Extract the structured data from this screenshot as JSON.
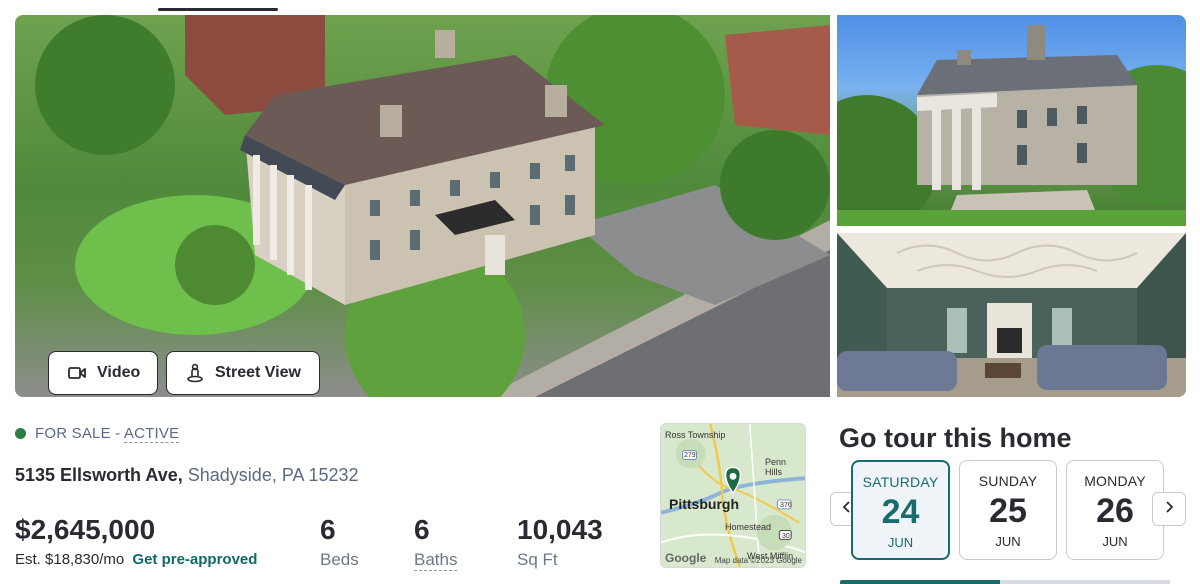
{
  "gallery": {
    "video_label": "Video",
    "street_view_label": "Street View"
  },
  "listing": {
    "status_prefix": "FOR SALE - ",
    "status_active": "ACTIVE",
    "status_color": "#2e7d49",
    "street": "5135 Ellsworth Ave,",
    "locality": "Shadyside, PA 15232",
    "price": "$2,645,000",
    "est_payment": "Est. $18,830/mo",
    "preapproved_link": "Get pre-approved",
    "beds_value": "6",
    "beds_label": "Beds",
    "baths_value": "6",
    "baths_label": "Baths",
    "sqft_value": "10,043",
    "sqft_label": "Sq Ft"
  },
  "map": {
    "label_ross": "Ross Township",
    "label_penn": "Penn Hills",
    "label_city": "Pittsburgh",
    "label_homestead": "Homestead",
    "label_mifflin": "West Mifflin",
    "hwy_279": "279",
    "hwy_376": "376",
    "hwy_30": "30",
    "google": "Google",
    "credit": "Map data ©2023 Google"
  },
  "tour": {
    "title": "Go tour this home",
    "days": [
      {
        "name": "SATURDAY",
        "num": "24",
        "month": "JUN",
        "selected": true
      },
      {
        "name": "SUNDAY",
        "num": "25",
        "month": "JUN",
        "selected": false
      },
      {
        "name": "MONDAY",
        "num": "26",
        "month": "JUN",
        "selected": false
      }
    ],
    "accent_color": "#1a6b6b"
  }
}
